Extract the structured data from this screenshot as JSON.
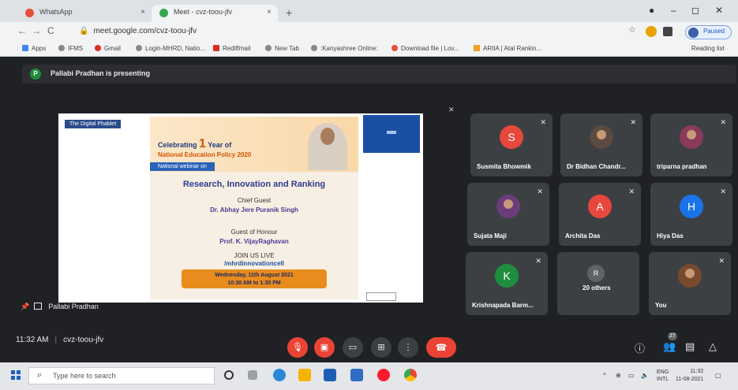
{
  "browser": {
    "tabs": [
      {
        "label": "WhatsApp",
        "close": "×"
      },
      {
        "label": "Meet - cvz-toou-jfv",
        "close": "×"
      }
    ],
    "new_tab": "+",
    "url": "meet.google.com/cvz-toou-jfv",
    "profile_label": "Paused",
    "bookmarks": [
      "Apps",
      "IFMS",
      "Gmail",
      "Login-MHRD, Natio...",
      "Rediffmail",
      "New Tab",
      ":Kanyashree Online:",
      "Download file | Lov...",
      "ARIIA | Atal Rankin..."
    ],
    "reading_list": "Reading list"
  },
  "meet": {
    "presenting_banner": "Pallabi Pradhan is presenting",
    "presenter_initial": "P",
    "presenter_name": "Pallabi Pradhan",
    "poster": {
      "logo_text": "The Digital Phablet",
      "celebrating": "Celebrating",
      "year_num": "1",
      "year_of": "Year of",
      "nep": "National Education Policy 2020",
      "webinar": "National webinar on",
      "headline": "Research, Innovation and Ranking",
      "chief_guest_label": "Chief Guest",
      "chief_guest_name": "Dr. Abhay Jere Puranik Singh",
      "guest_honour_label": "Guest of Honour",
      "guest_honour_name": "Prof. K. VijayRaghavan",
      "join": "JOIN US LIVE",
      "handle": "/mhrdinnovationcell",
      "date": "Wednesday, 11th August 2021",
      "time": "10:30 AM to 1:30 PM"
    },
    "participants": [
      {
        "name": "Susmita Bhowmik",
        "initial": "S",
        "color": "#e8473d"
      },
      {
        "name": "Dr Bidhan Chandr...",
        "initial": "",
        "color": "#5b4a3f"
      },
      {
        "name": "triparna pradhan",
        "initial": "",
        "color": "#8b3a5a"
      },
      {
        "name": "Sujata Maji",
        "initial": "",
        "color": "#6a3c7a"
      },
      {
        "name": "Archita Das",
        "initial": "A",
        "color": "#e8473d"
      },
      {
        "name": "Hiya Das",
        "initial": "H",
        "color": "#1a73e8"
      },
      {
        "name": "Krishnapada Barm...",
        "initial": "K",
        "color": "#1e8e3e"
      },
      {
        "name": "20 others",
        "initial": "R",
        "color": "#5f6368"
      },
      {
        "name": "You",
        "initial": "",
        "color": "#7a4a2e"
      }
    ],
    "time": "11:32 AM",
    "meeting_code": "cvz-toou-jfv",
    "participant_count": "27"
  },
  "taskbar": {
    "search_placeholder": "Type here to search",
    "lang_top": "ENG",
    "lang_bottom": "INTL",
    "clock_time": "11:32",
    "clock_date": "11-08-2021"
  }
}
